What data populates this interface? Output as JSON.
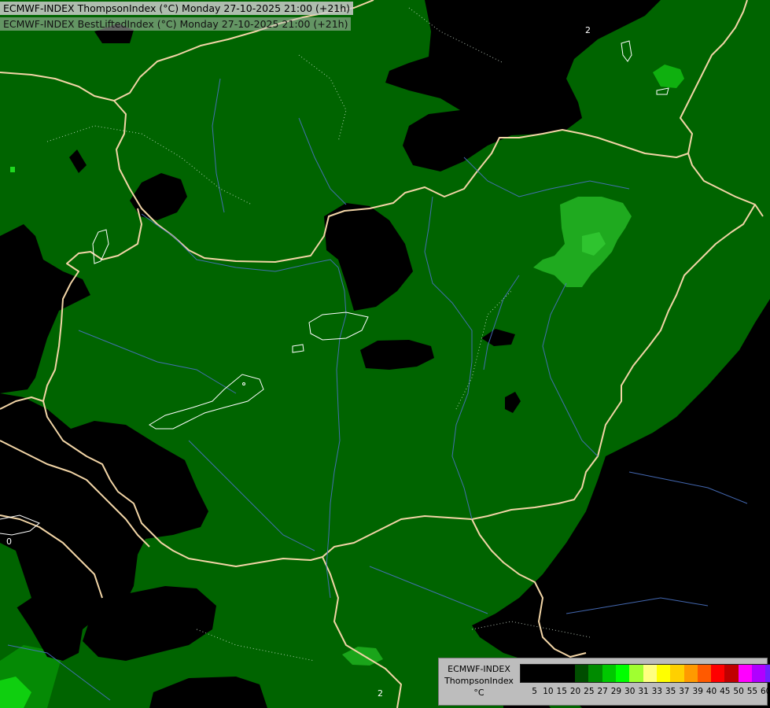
{
  "header": {
    "line1": "ECMWF-INDEX ThompsonIndex (°C) Monday 27-10-2025 21:00 (+21h)",
    "line2": "ECMWF-INDEX BestLiftedIndex (°C) Monday 27-10-2025 21:00 (+21h)"
  },
  "map": {
    "contour_labels": [
      "2",
      "0",
      "2"
    ],
    "colors": {
      "background_low": "#000000",
      "main_field": "#006400",
      "mid_field": "#058a05",
      "bright_field": "#0fcf0f",
      "border_line": "#f2d5a6",
      "river_line": "#4a72c2",
      "contour_white": "#ffffff"
    }
  },
  "legend": {
    "title_lines": [
      "ECMWF-INDEX",
      "ThompsonIndex",
      "°C"
    ],
    "ticks": [
      "5",
      "10",
      "15",
      "20",
      "25",
      "27",
      "29",
      "30",
      "31",
      "33",
      "35",
      "37",
      "39",
      "40",
      "45",
      "50",
      "55",
      "60"
    ],
    "swatch_colors": [
      "#000000",
      "#000000",
      "#000000",
      "#000000",
      "#004d00",
      "#008b00",
      "#00c800",
      "#00ff00",
      "#a0ff30",
      "#ffff80",
      "#ffff00",
      "#ffd000",
      "#ff9a00",
      "#ff5a00",
      "#ff0000",
      "#c00000",
      "#ff00ff",
      "#b000ff",
      "#7020ff",
      "#0000ff"
    ]
  }
}
